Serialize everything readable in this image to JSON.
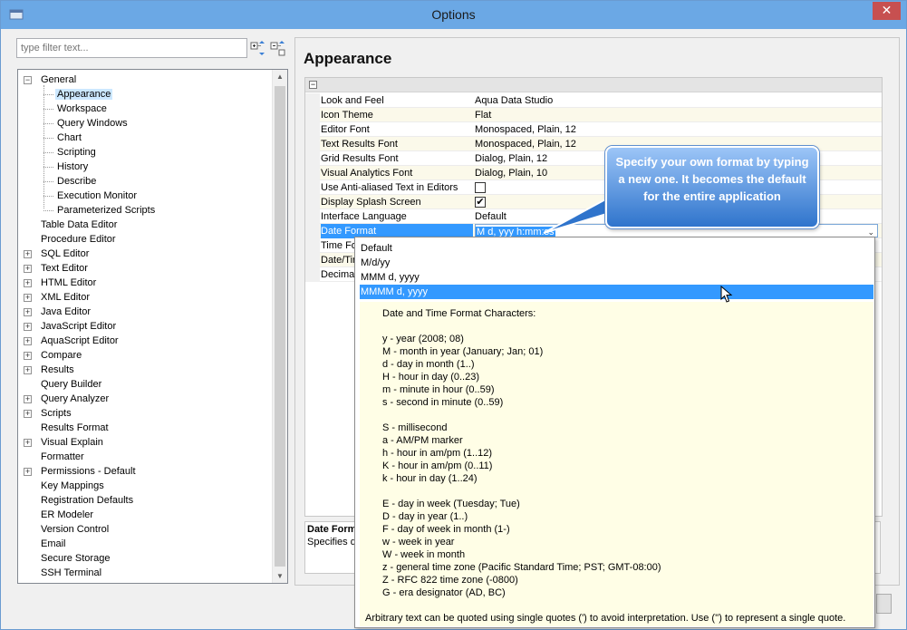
{
  "window": {
    "title": "Options",
    "close_label": "✕"
  },
  "filter": {
    "placeholder": "type filter text..."
  },
  "tree": {
    "items": [
      {
        "label": "General",
        "level": 0,
        "expander": "−"
      },
      {
        "label": "Appearance",
        "level": 1,
        "selected": true
      },
      {
        "label": "Workspace",
        "level": 1
      },
      {
        "label": "Query Windows",
        "level": 1
      },
      {
        "label": "Chart",
        "level": 1
      },
      {
        "label": "Scripting",
        "level": 1
      },
      {
        "label": "History",
        "level": 1
      },
      {
        "label": "Describe",
        "level": 1
      },
      {
        "label": "Execution Monitor",
        "level": 1
      },
      {
        "label": "Parameterized Scripts",
        "level": 1
      },
      {
        "label": "Table Data Editor",
        "level": 0
      },
      {
        "label": "Procedure Editor",
        "level": 0
      },
      {
        "label": "SQL Editor",
        "level": 0,
        "expander": "+"
      },
      {
        "label": "Text Editor",
        "level": 0,
        "expander": "+"
      },
      {
        "label": "HTML Editor",
        "level": 0,
        "expander": "+"
      },
      {
        "label": "XML Editor",
        "level": 0,
        "expander": "+"
      },
      {
        "label": "Java Editor",
        "level": 0,
        "expander": "+"
      },
      {
        "label": "JavaScript Editor",
        "level": 0,
        "expander": "+"
      },
      {
        "label": "AquaScript Editor",
        "level": 0,
        "expander": "+"
      },
      {
        "label": "Compare",
        "level": 0,
        "expander": "+"
      },
      {
        "label": "Results",
        "level": 0,
        "expander": "+"
      },
      {
        "label": "Query Builder",
        "level": 0
      },
      {
        "label": "Query Analyzer",
        "level": 0,
        "expander": "+"
      },
      {
        "label": "Scripts",
        "level": 0,
        "expander": "+"
      },
      {
        "label": "Results Format",
        "level": 0
      },
      {
        "label": "Visual Explain",
        "level": 0,
        "expander": "+"
      },
      {
        "label": "Formatter",
        "level": 0
      },
      {
        "label": "Permissions - Default",
        "level": 0,
        "expander": "+"
      },
      {
        "label": "Key Mappings",
        "level": 0
      },
      {
        "label": "Registration Defaults",
        "level": 0
      },
      {
        "label": "ER Modeler",
        "level": 0
      },
      {
        "label": "Version Control",
        "level": 0
      },
      {
        "label": "Email",
        "level": 0
      },
      {
        "label": "Secure Storage",
        "level": 0
      },
      {
        "label": "SSH Terminal",
        "level": 0
      }
    ]
  },
  "panel": {
    "title": "Appearance",
    "collapse": "−"
  },
  "properties": [
    {
      "name": "Look and Feel",
      "value": "Aqua Data Studio"
    },
    {
      "name": "Icon Theme",
      "value": "Flat"
    },
    {
      "name": "Editor Font",
      "value": "Monospaced, Plain, 12"
    },
    {
      "name": "Text Results Font",
      "value": "Monospaced, Plain, 12"
    },
    {
      "name": "Grid Results Font",
      "value": "Dialog, Plain, 12"
    },
    {
      "name": "Visual Analytics Font",
      "value": "Dialog, Plain, 10"
    },
    {
      "name": "Use Anti-aliased Text in Editors",
      "value": ""
    },
    {
      "name": "Display Splash Screen",
      "value": "✔"
    },
    {
      "name": "Interface Language",
      "value": "Default"
    },
    {
      "name": "Date Format",
      "value": "M d, yyy h:mm:ss"
    },
    {
      "name": "Time Fo",
      "value": ""
    },
    {
      "name": "Date/Tir",
      "value": ""
    },
    {
      "name": "Decimal",
      "value": ""
    }
  ],
  "description": {
    "title": "Date Form",
    "text": "Specifies da"
  },
  "dropdown": {
    "options": [
      "Default",
      "M/d/yy",
      "MMM d, yyyy",
      "MMMM d, yyyy"
    ],
    "selected_index": 3,
    "help": [
      "Date and Time Format Characters:",
      "",
      "y - year (2008; 08)",
      "M - month in year (January; Jan; 01)",
      "d - day in month (1..)",
      "H - hour in day (0..23)",
      "m - minute in hour (0..59)",
      "s - second in minute (0..59)",
      "",
      "S - millisecond",
      "a - AM/PM marker",
      "h - hour in am/pm (1..12)",
      "K - hour in am/pm (0..11)",
      "k - hour in day (1..24)",
      "",
      "E - day in week (Tuesday; Tue)",
      "D - day in year (1..)",
      "F - day of week in month (1-)",
      "w - week in year",
      "W - week in month",
      "z - general time zone (Pacific Standard Time; PST; GMT-08:00)",
      "Z - RFC 822 time zone (-0800)",
      "G - era designator (AD, BC)",
      "",
      "Arbitrary text can be quoted using single quotes (') to avoid interpretation.  Use ('') to represent a single quote."
    ]
  },
  "callout": {
    "text": "Specify your own format by typing a new one. It becomes the default for the entire application"
  },
  "colors": {
    "titlebar": "#6ba8e5",
    "selection": "#3399ff",
    "callout": "#2f74cc",
    "close": "#c75050"
  }
}
